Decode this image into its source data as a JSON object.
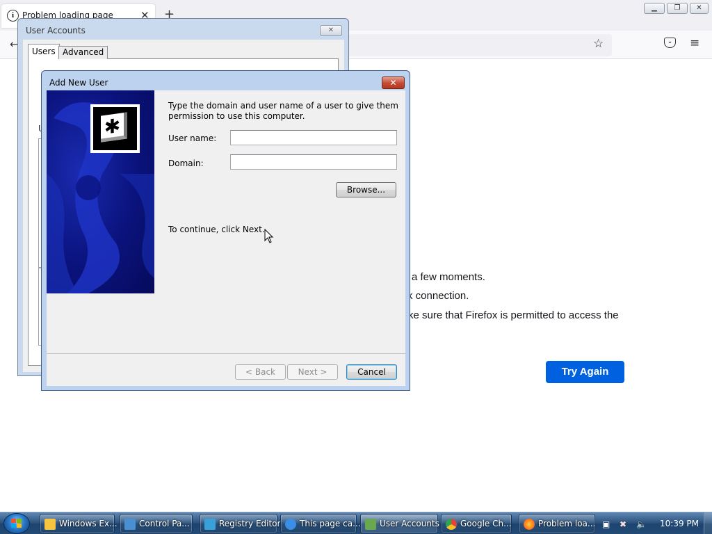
{
  "firefox": {
    "tab_title": "Problem loading page",
    "error_lines": [
      "a few moments.",
      "k connection.",
      "ke sure that Firefox is permitted to access the"
    ],
    "try_again_label": "Try Again"
  },
  "user_accounts": {
    "title": "User Accounts",
    "tabs": [
      "Users",
      "Advanced"
    ],
    "fragments": [
      "U"
    ]
  },
  "add_user_dialog": {
    "title": "Add New User",
    "close_glyph": "✕",
    "instructions": "Type the domain and user name of a user to give them",
    "instructions_line2": "permission to use this computer.",
    "username_label": "User name:",
    "username_value": "",
    "domain_label": "Domain:",
    "domain_value": "",
    "browse_label": "Browse...",
    "continue_text": "To continue, click Next.",
    "back_label": "< Back",
    "next_label": "Next >",
    "cancel_label": "Cancel"
  },
  "taskbar": {
    "items": [
      {
        "label": "Windows Ex...",
        "icon": "folder-icon",
        "color": "#f5c542"
      },
      {
        "label": "Control Pa...",
        "icon": "control-panel-icon",
        "color": "#4a8fd1"
      },
      {
        "label": "Registry Editor",
        "icon": "registry-editor-icon",
        "color": "#3aa0d8"
      },
      {
        "label": "This page ca...",
        "icon": "internet-explorer-icon",
        "color": "#3a8ee6"
      },
      {
        "label": "User Accounts",
        "icon": "user-accounts-icon",
        "color": "#6aa84f"
      },
      {
        "label": "Google Ch...",
        "icon": "chrome-icon",
        "color": "#e3433b"
      },
      {
        "label": "Problem loa...",
        "icon": "firefox-icon",
        "color": "#ff7a18"
      }
    ],
    "clock": "10:39 PM"
  }
}
